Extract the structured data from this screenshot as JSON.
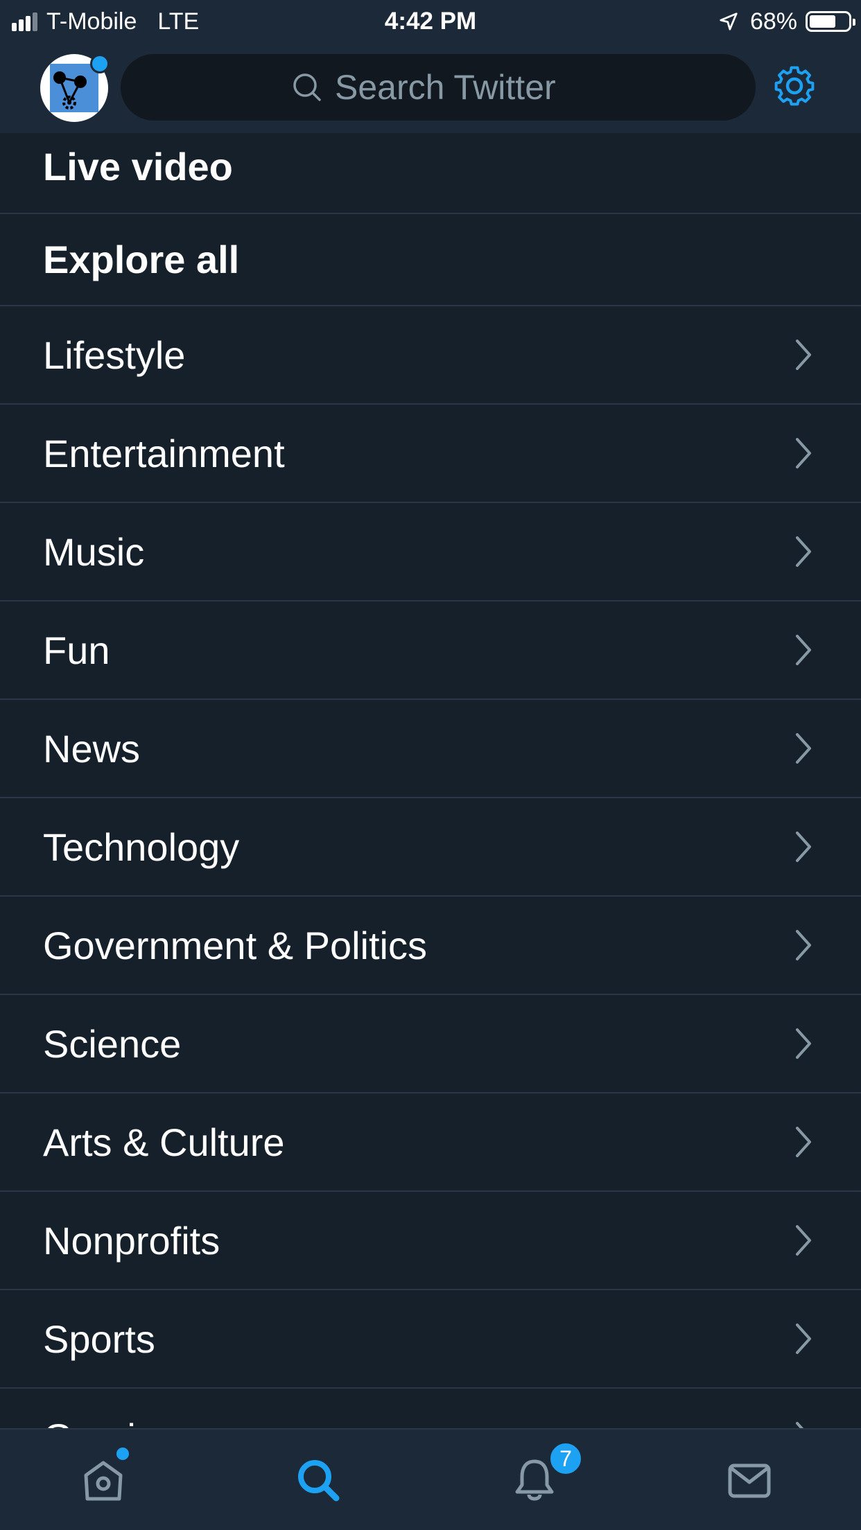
{
  "status_bar": {
    "carrier": "T-Mobile",
    "network": "LTE",
    "time": "4:42 PM",
    "battery_percent": "68%",
    "battery_level": 0.68,
    "signal_bars_active": 3,
    "signal_bars_total": 4
  },
  "header": {
    "search_placeholder": "Search Twitter",
    "avatar_has_notification": true
  },
  "sections": {
    "live_video": "Live video",
    "explore_all": "Explore all"
  },
  "categories": [
    {
      "label": "Lifestyle"
    },
    {
      "label": "Entertainment"
    },
    {
      "label": "Music"
    },
    {
      "label": "Fun"
    },
    {
      "label": "News"
    },
    {
      "label": "Technology"
    },
    {
      "label": "Government & Politics"
    },
    {
      "label": "Science"
    },
    {
      "label": "Arts & Culture"
    },
    {
      "label": "Nonprofits"
    },
    {
      "label": "Sports"
    },
    {
      "label": "Gaming"
    }
  ],
  "tab_bar": {
    "active_tab": "search",
    "notifications_badge": "7",
    "home_has_dot": true
  },
  "colors": {
    "background": "#15202b",
    "bars": "#1c2938",
    "accent": "#1da1f2",
    "secondary_text": "#8899a6",
    "divider": "#2a3746"
  }
}
